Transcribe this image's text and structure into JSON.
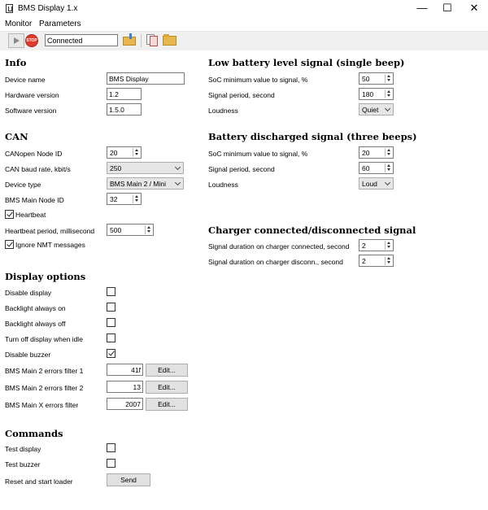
{
  "window": {
    "title": "BMS Display 1.x",
    "minimize_glyph": "—",
    "maximize_glyph": "☐",
    "close_glyph": "✕"
  },
  "menu": {
    "items": [
      "Monitor",
      "Parameters"
    ]
  },
  "toolbar": {
    "stop_label": "STOP",
    "status_value": "Connected",
    "icons": [
      "play-icon",
      "stop-icon",
      "import-icon",
      "copy-icon",
      "open-folder-icon"
    ]
  },
  "info": {
    "heading": "Info",
    "device_name_label": "Device name",
    "device_name_value": "BMS Display",
    "hardware_version_label": "Hardware version",
    "hardware_version_value": "1.2",
    "software_version_label": "Software version",
    "software_version_value": "1.5.0"
  },
  "can": {
    "heading": "CAN",
    "node_id_label": "CANopen Node ID",
    "node_id_value": "20",
    "baud_label": "CAN baud rate, kbit/s",
    "baud_value": "250",
    "device_type_label": "Device type",
    "device_type_value": "BMS Main 2 / Mini",
    "main_node_label": "BMS Main Node ID",
    "main_node_value": "32",
    "heartbeat_label": "Heartbeat",
    "heartbeat_checked": true,
    "heartbeat_period_label": "Heartbeat period, millisecond",
    "heartbeat_period_value": "500",
    "ignore_nmt_label": "Ignore NMT messages",
    "ignore_nmt_checked": true
  },
  "display": {
    "heading": "Display options",
    "disable_display_label": "Disable display",
    "backlight_on_label": "Backlight always on",
    "backlight_off_label": "Backlight always off",
    "turn_off_idle_label": "Turn off display when idle",
    "disable_buzzer_label": "Disable buzzer",
    "disable_buzzer_checked": true,
    "filter1_label": "BMS Main 2 errors filter 1",
    "filter1_value": "41f",
    "filter2_label": "BMS Main 2 errors filter 2",
    "filter2_value": "13",
    "filterx_label": "BMS Main X errors filter",
    "filterx_value": "2007",
    "edit_label": "Edit..."
  },
  "commands": {
    "heading": "Commands",
    "test_display_label": "Test display",
    "test_buzzer_label": "Test buzzer",
    "reset_label": "Reset and start loader",
    "send_label": "Send"
  },
  "low_battery": {
    "heading": "Low battery level signal (single beep)",
    "soc_label": "SoC minimum value to signal, %",
    "soc_value": "50",
    "period_label": "Signal period, second",
    "period_value": "180",
    "loudness_label": "Loudness",
    "loudness_value": "Quiet"
  },
  "discharged": {
    "heading": "Battery discharged signal (three beeps)",
    "soc_label": "SoC minimum value to signal, %",
    "soc_value": "20",
    "period_label": "Signal period, second",
    "period_value": "60",
    "loudness_label": "Loudness",
    "loudness_value": "Loud"
  },
  "charger": {
    "heading": "Charger connected/disconnected signal",
    "connected_label": "Signal duration on charger connected, second",
    "connected_value": "2",
    "disconnected_label": "Signal duration on charger disconn., second",
    "disconnected_value": "2"
  }
}
